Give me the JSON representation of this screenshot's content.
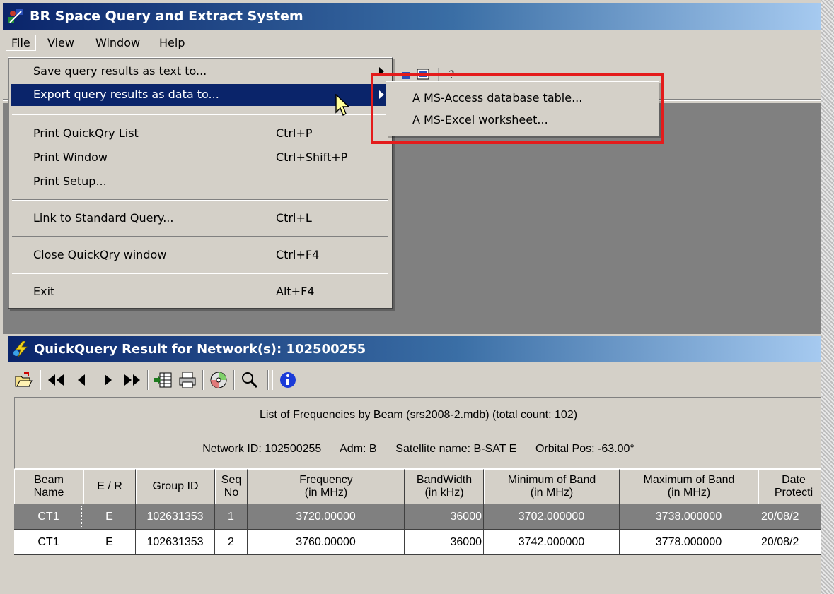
{
  "window": {
    "title": "BR Space Query and Extract System"
  },
  "menubar": {
    "items": [
      "File",
      "View",
      "Window",
      "Help"
    ]
  },
  "file_menu": {
    "items": [
      {
        "label": "Save query results as text to...",
        "submenu": true
      },
      {
        "label": "Export query results as data to...",
        "submenu": true,
        "highlighted": true
      },
      {
        "label": "Print QuickQry List",
        "accel": "Ctrl+P"
      },
      {
        "label": "Print Window",
        "accel": "Ctrl+Shift+P"
      },
      {
        "label": "Print Setup..."
      },
      {
        "label": "Link to Standard Query...",
        "accel": "Ctrl+L"
      },
      {
        "label": "Close QuickQry window",
        "accel": "Ctrl+F4"
      },
      {
        "label": "Exit",
        "accel": "Alt+F4"
      }
    ]
  },
  "submenu": {
    "items": [
      "A MS-Access database table...",
      "A MS-Excel worksheet..."
    ]
  },
  "annotation": {
    "color": "#e41b1b"
  },
  "quickquery": {
    "title": "QuickQuery Result for Network(s): 102500255",
    "toolbar_icons": [
      "open-folder-icon",
      "first-record-icon",
      "previous-record-icon",
      "next-record-icon",
      "last-record-icon",
      "export-grid-icon",
      "print-icon",
      "cd-icon",
      "search-icon",
      "info-icon"
    ],
    "list_title": "List of Frequencies by Beam  (srs2008-2.mdb)  (total count: 102)",
    "network_id": "Network ID: 102500255",
    "adm": "Adm: B",
    "satellite": "Satellite name: B-SAT E",
    "orbital": "Orbital Pos: -63.00°",
    "columns": [
      "Beam\nName",
      "E / R",
      "Group ID",
      "Seq\nNo",
      "Frequency\n(in MHz)",
      "BandWidth\n(in kHz)",
      "Minimum of Band\n(in MHz)",
      "Maximum of Band\n(in MHz)",
      "Date\nProtecti"
    ],
    "rows": [
      [
        "CT1",
        "E",
        "102631353",
        "1",
        "3720.00000",
        "36000",
        "3702.000000",
        "3738.000000",
        "20/08/2"
      ],
      [
        "CT1",
        "E",
        "102631353",
        "2",
        "3760.00000",
        "36000",
        "3742.000000",
        "3778.000000",
        "20/08/2"
      ]
    ]
  },
  "colors": {
    "title_dark": "#0a246a",
    "title_light": "#a6caf0",
    "face": "#d4d0c8",
    "mdi_bg": "#808080"
  }
}
